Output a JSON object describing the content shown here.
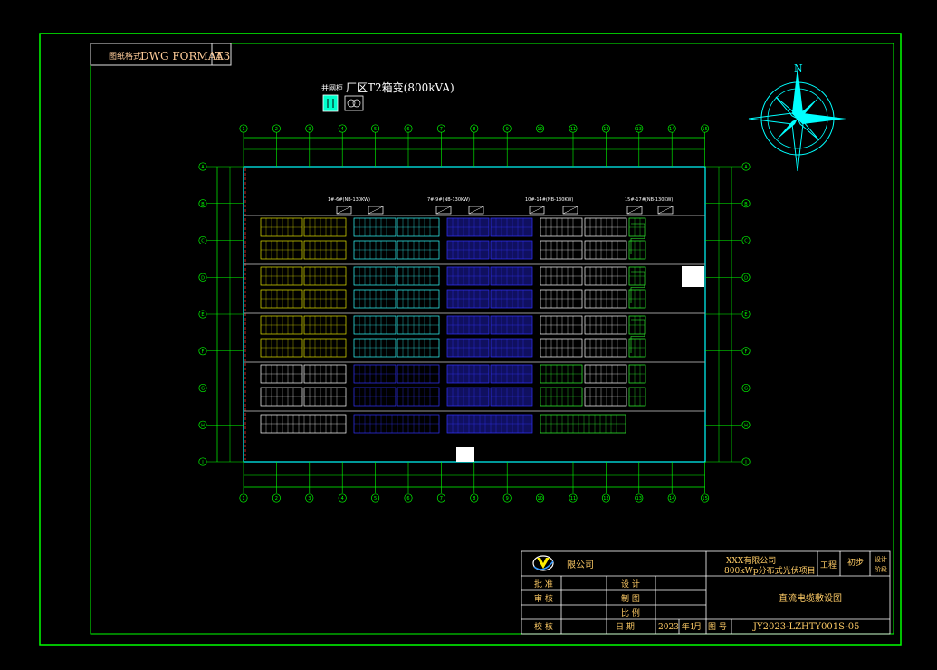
{
  "format_box": {
    "label": "图纸格式",
    "format": "DWG FORMAT",
    "size": "A3"
  },
  "transformer": {
    "tag": "并网柜",
    "label": "厂区T2箱变(800kVA)"
  },
  "compass": {
    "north": "N"
  },
  "inverters": [
    "1#-6#(NB-130KW)",
    "7#-9#(NB-130KW)",
    "10#-14#(NB-130KW)",
    "15#-17#(NB-130KW)"
  ],
  "grid_numbers_top": [
    "1",
    "2",
    "3",
    "4",
    "5",
    "6",
    "7",
    "8",
    "9",
    "10",
    "11",
    "12",
    "13",
    "14",
    "15"
  ],
  "grid_letters_side": [
    "A",
    "B",
    "C",
    "D",
    "E",
    "F",
    "G",
    "H",
    "I"
  ],
  "title_block": {
    "company": "限公司",
    "client_line1": "XXX有限公司",
    "client_line2": "800kWp分布式光伏项目",
    "engineering": "工程",
    "stage": "初步",
    "design_stage_1": "设计",
    "design_stage_2": "阶段",
    "approve": "批 准",
    "review": "审 核",
    "check": "校 核",
    "design": "设 计",
    "draw": "制 图",
    "scale": "比 例",
    "date_label": "日 期",
    "date_value": "2023 年1",
    "month_label": "月",
    "drawing_no_label": "图 号",
    "drawing_no": "JY2023-LZHTY001S-05",
    "drawing_title": "直流电缆敷设图"
  }
}
